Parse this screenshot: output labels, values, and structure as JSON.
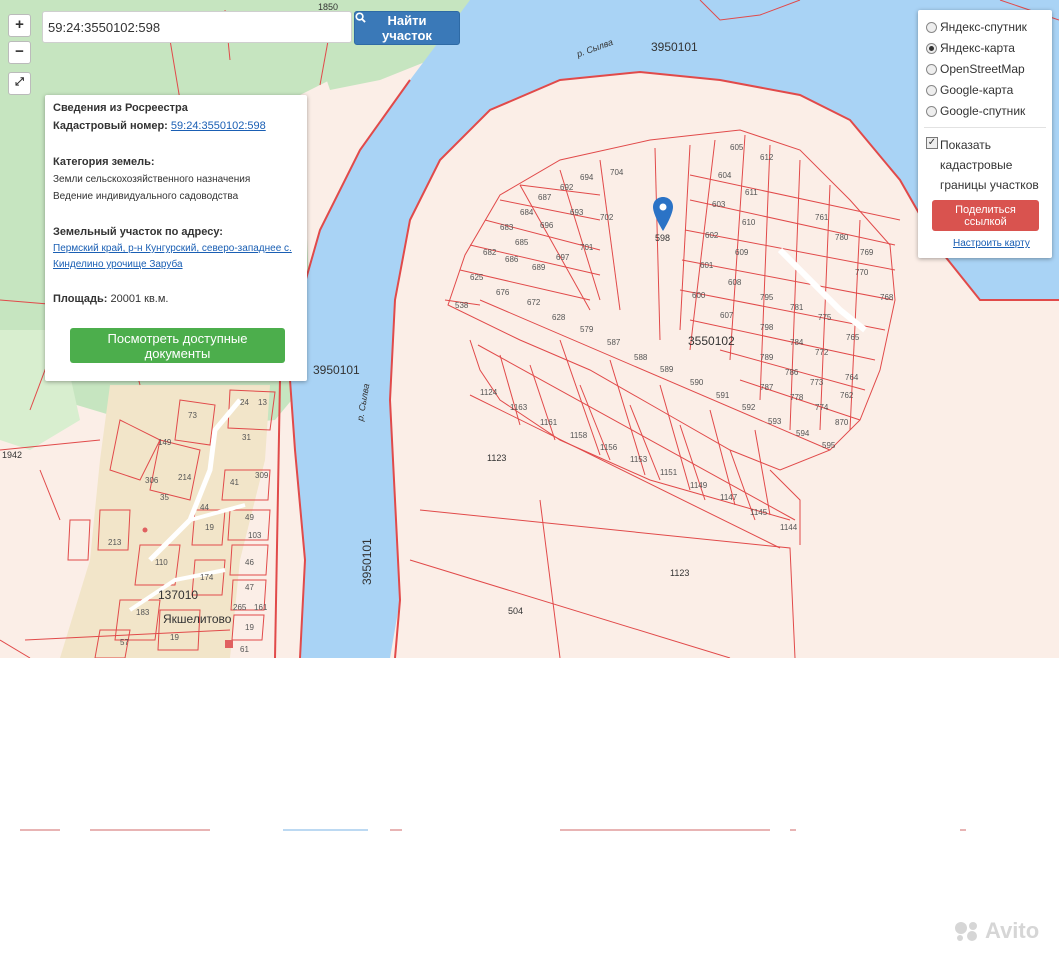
{
  "search": {
    "value": "59:24:3550102:598",
    "button_label": "Найти участок",
    "icon": "search-icon"
  },
  "zoom": {
    "plus": "+",
    "minus": "−",
    "fullscreen_icon": "expand-icon"
  },
  "info_panel": {
    "heading": "Сведения из Росреестра",
    "cadastral_label": "Кадастровый номер:",
    "cadastral_number": "59:24:3550102:598",
    "category_label": "Категория земель:",
    "category_line1": "Земли сельскохозяйственного назначения",
    "category_line2": "Ведение индивидуального садоводства",
    "address_label": "Земельный участок по адресу:",
    "address_line1": "Пермский край, р-н Кунгурский, северо-западнее с.",
    "address_line2": "Кинделино урочище Заруба",
    "area_label": "Площадь:",
    "area_value": "20001 кв.м.",
    "docs_button": "Посмотреть доступные документы"
  },
  "layers_panel": {
    "options": [
      {
        "label": "Яндекс-спутник",
        "selected": false
      },
      {
        "label": "Яндекс-карта",
        "selected": true
      },
      {
        "label": "OpenStreetMap",
        "selected": false
      },
      {
        "label": "Google-карта",
        "selected": false
      },
      {
        "label": "Google-спутник",
        "selected": false
      }
    ],
    "show_borders_line1": "Показать",
    "show_borders_line2": "кадастровые",
    "show_borders_line3": "границы участков",
    "show_borders_checked": true,
    "share_button": "Поделиться ссылкой",
    "config_link": "Настроить карту"
  },
  "map_labels": {
    "block_top": "3950101",
    "block_left": "3950101",
    "block_right_vertical": "3950101",
    "block_center": "3550102",
    "block_village": "137010",
    "village": "Якшелитово",
    "river_top": "р. Сылва",
    "river_middle": "р. Сылва",
    "plot_selected": "598",
    "plot_1123a": "1123",
    "plot_1123b": "1123",
    "plot_504": "504",
    "plot_1942": "1942",
    "plot_1850": "1850"
  },
  "colors": {
    "water": "#a9d3f5",
    "forest": "#c6e5c0",
    "land": "#fbeee7",
    "parcel_line": "#e14a4a",
    "marker": "#2b73c6"
  },
  "watermark": "Avito"
}
